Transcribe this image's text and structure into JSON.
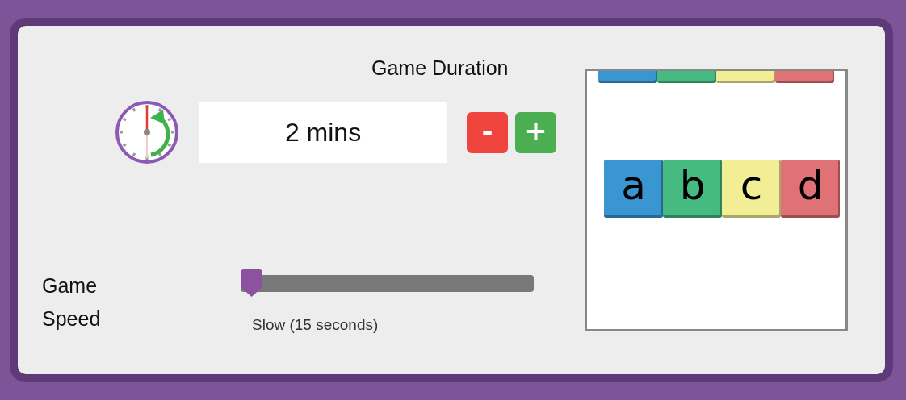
{
  "duration": {
    "title": "Game Duration",
    "value": "2 mins",
    "buttons": [
      "-",
      "+"
    ]
  },
  "speed": {
    "label": "Game Speed",
    "level": 0,
    "reading": "Slow (15 seconds)"
  },
  "preview": {
    "rows": [
      {
        "kind": "cut",
        "tiles": [
          {
            "color": "#3a96d0"
          },
          {
            "color": "#45bb82"
          },
          {
            "color": "#f2ee96"
          },
          {
            "color": "#e07276"
          }
        ]
      },
      {
        "kind": "full",
        "tiles": [
          {
            "letter": "a",
            "color": "#3a96d0"
          },
          {
            "letter": "b",
            "color": "#45bb82"
          },
          {
            "letter": "c",
            "color": "#f2ee96"
          },
          {
            "letter": "d",
            "color": "#e07276"
          }
        ]
      }
    ]
  }
}
